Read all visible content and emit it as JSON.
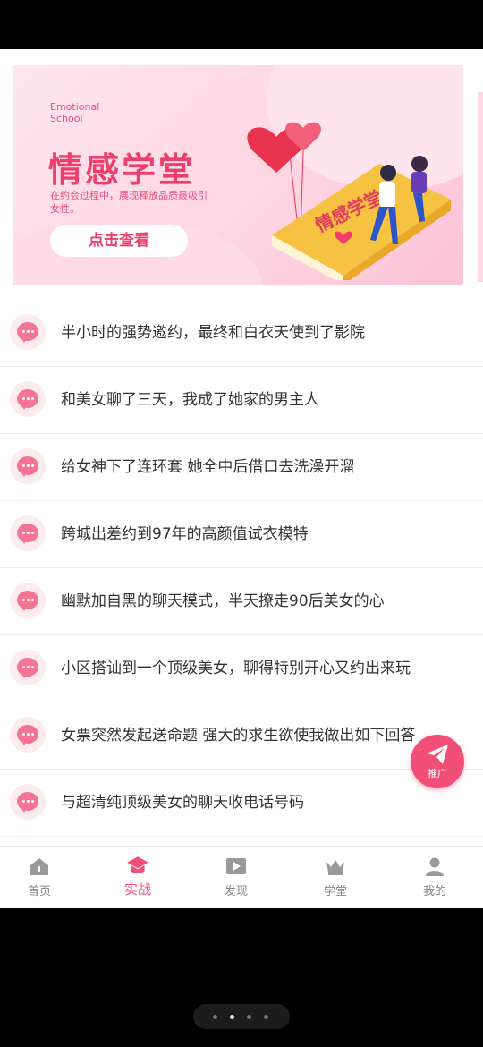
{
  "banner": {
    "en_title": "Emotional School",
    "title": "情感学堂",
    "description": "在约会过程中，展现释放品质最吸引女性。",
    "cta_label": "点击查看",
    "book_title": "情感学堂",
    "colors": {
      "primary": "#ec3f6c",
      "background": "#ffd6e4"
    }
  },
  "articles": [
    {
      "title": "半小时的强势邀约，最终和白衣天使到了影院"
    },
    {
      "title": "和美女聊了三天，我成了她家的男主人"
    },
    {
      "title": "给女神下了连环套 她全中后借口去洗澡开溜"
    },
    {
      "title": "跨城出差约到97年的高颜值试衣模特"
    },
    {
      "title": "幽默加自黑的聊天模式，半天撩走90后美女的心"
    },
    {
      "title": "小区搭讪到一个顶级美女，聊得特别开心又约出来玩"
    },
    {
      "title": "女票突然发起送命题 强大的求生欲使我做出如下回答"
    },
    {
      "title": "与超清纯顶级美女的聊天收电话号码"
    }
  ],
  "fab": {
    "label": "推广",
    "icon": "paper-plane-icon"
  },
  "tabbar": {
    "active": "实战",
    "items": [
      {
        "label": "首页",
        "icon": "home-icon"
      },
      {
        "label": "实战",
        "icon": "graduation-cap-icon"
      },
      {
        "label": "发现",
        "icon": "play-icon"
      },
      {
        "label": "学堂",
        "icon": "crown-icon"
      },
      {
        "label": "我的",
        "icon": "user-icon"
      }
    ]
  },
  "accent_color": "#f24f78"
}
